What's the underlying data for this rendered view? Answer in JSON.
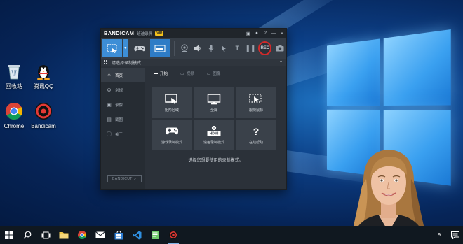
{
  "desktop": {
    "icons": [
      {
        "name": "recycle-bin",
        "label": "回收站"
      },
      {
        "name": "tencent-qq",
        "label": "腾讯QQ"
      },
      {
        "name": "chrome",
        "label": "Chrome"
      },
      {
        "name": "bandicam",
        "label": "Bandicam"
      }
    ]
  },
  "bandicam": {
    "logo": "BANDICAM",
    "version_label": "班迪录屏",
    "vip_badge": "VIP",
    "rec_label": "REC",
    "subbar_title": "请选择录制模式",
    "sidebar": [
      {
        "label": "首页",
        "icon": "home-icon",
        "active": true
      },
      {
        "label": "常规",
        "icon": "gear-icon",
        "active": false
      },
      {
        "label": "录像",
        "icon": "video-icon",
        "active": false
      },
      {
        "label": "截图",
        "icon": "image-icon",
        "active": false
      },
      {
        "label": "关于",
        "icon": "info-icon",
        "active": false
      }
    ],
    "bandicut_label": "BANDICUT ↗",
    "tabs": [
      {
        "label": "开始",
        "active": true
      },
      {
        "label": "视频",
        "active": false
      },
      {
        "label": "图像",
        "active": false
      }
    ],
    "modes": [
      {
        "label": "矩形区域",
        "icon": "rectangle-area-icon"
      },
      {
        "label": "全屏",
        "icon": "fullscreen-icon"
      },
      {
        "label": "跟随鼠标",
        "icon": "around-mouse-icon"
      },
      {
        "label": "游戏录制模式",
        "icon": "gamepad-icon"
      },
      {
        "label": "设备录制模式",
        "icon": "hdmi-icon"
      },
      {
        "label": "在线帮助",
        "icon": "question-icon"
      }
    ],
    "hdmi_text": "HDMI",
    "hint": "选择您想要使用的录制模式。"
  },
  "taskbar": {
    "tray_number": "9",
    "items": [
      "windows-start-icon",
      "search-icon",
      "task-view-icon",
      "file-explorer-icon",
      "chrome-icon",
      "mail-icon",
      "store-icon",
      "vscode-icon",
      "notepad-icon",
      "bandicam-icon"
    ]
  }
}
